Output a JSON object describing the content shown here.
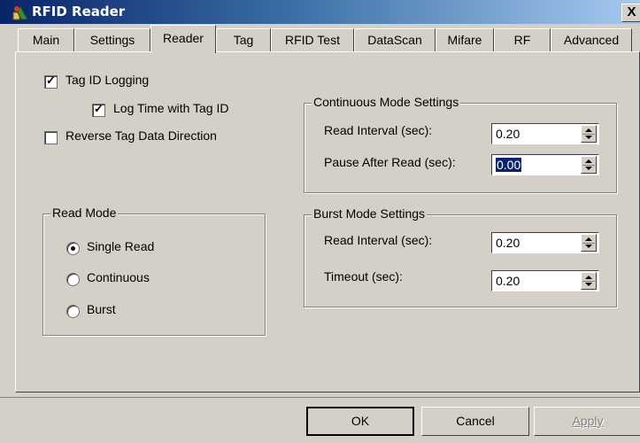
{
  "window": {
    "title": "RFID Reader",
    "close_label": "X"
  },
  "tabs": [
    "Main",
    "Settings",
    "Reader",
    "Tag",
    "RFID Test",
    "DataScan",
    "Mifare",
    "RF",
    "Advanced"
  ],
  "active_tab": "Reader",
  "options": {
    "tag_id_logging": {
      "label": "Tag ID Logging",
      "checked": true
    },
    "log_time": {
      "label": "Log Time with Tag ID",
      "checked": true
    },
    "reverse_direction": {
      "label": "Reverse Tag Data Direction",
      "checked": false
    }
  },
  "read_mode": {
    "title": "Read Mode",
    "options": [
      "Single Read",
      "Continuous",
      "Burst"
    ],
    "selected": "Single Read"
  },
  "continuous": {
    "title": "Continuous Mode Settings",
    "read_interval_label": "Read Interval (sec):",
    "read_interval_value": "0.20",
    "pause_label": "Pause After Read (sec):",
    "pause_value": "0.00"
  },
  "burst": {
    "title": "Burst Mode Settings",
    "read_interval_label": "Read Interval (sec):",
    "read_interval_value": "0.20",
    "timeout_label": "Timeout (sec):",
    "timeout_value": "0.20"
  },
  "buttons": {
    "ok": "OK",
    "cancel": "Cancel",
    "apply": "Apply"
  },
  "colors": {
    "face": "#d4d0c8",
    "title_start": "#0a246a",
    "selection": "#0a246a"
  }
}
